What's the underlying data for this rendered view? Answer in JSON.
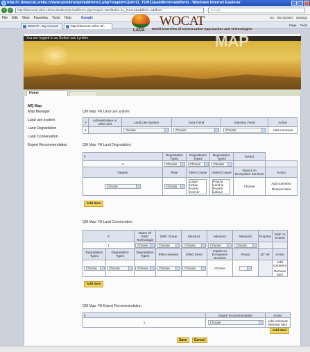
{
  "window": {
    "title": "http://c.dewocat.unibe.ch/wocatonline/qm/addform1.php?mapid=1&id=11_TUH11&addform=addform - Windows Internet Explorer",
    "min": "_",
    "max": "□",
    "close": "x"
  },
  "address": {
    "url": "http://dewocat.unibe.ch/wocatonline/qm/addform1.php?mapid=1&mf0okni=11_TUH11&addform=addform",
    "search_placeholder": "Google"
  },
  "menu": {
    "items": [
      "File",
      "Edit",
      "View",
      "Favorites",
      "Tools",
      "Help"
    ],
    "google_label": "Google",
    "go_label": "Go",
    "blocked_label": "86 blocked",
    "settings_label": "Settings",
    "tools_label": "Tools"
  },
  "tabs": [
    {
      "label": "WOCAT - My Account"
    },
    {
      "label": "http://dewocat.unibe.ch/..."
    }
  ],
  "tab_tools": {
    "page": "Page",
    "tools": "Tools"
  },
  "login": {
    "text": "You are logged in as Godert van Lynden"
  },
  "banner": {
    "lada": "LADA",
    "wocat": "WOCAT",
    "subtitle": "World Overview of Conservation Approaches and Technologies",
    "map": "MAP"
  },
  "home_tab": "Home",
  "sidebar": {
    "items": [
      "MQ Map",
      "Map Manager",
      "Land use system",
      "Land Degradation",
      "Land Conservation",
      "Expert Recommendation"
    ]
  },
  "land_use": {
    "title": "QM Map: Fill Land use system.",
    "headers": [
      "#",
      "Administrative or other unit",
      "Land Use System",
      "Area Trend",
      "Intensity Trend",
      "Action"
    ],
    "row": {
      "n": "1",
      "sel1": "choose",
      "sel2": "Choose",
      "sel3": "Choose",
      "action": "Add comment"
    }
  },
  "land_deg": {
    "title": "QM Map: Fill Land Degradation.",
    "headers": [
      "#",
      "Degradation Type1",
      "Degradation Type2",
      "Degradation Type3",
      "Extent"
    ],
    "row_n": "1",
    "sel": "Choose",
    "sub_headers": [
      "Degree",
      "Rate",
      "Direct cause",
      "Indirect cause",
      "Impact on Ecosystem Services",
      "Action"
    ],
    "direct_opts": [
      "Large-",
      "Urban",
      "Forest",
      "Conver"
    ],
    "indirect_opts": [
      "Popula",
      "Land te",
      "Poverti",
      "Labour"
    ],
    "add_comment": "Add comment",
    "remove": "Remove Item",
    "add_item": "Add Item"
  },
  "land_cons": {
    "title": "QM Map: Fill Land Conservation.",
    "headers": [
      "#",
      "Name Of SWC Technologie",
      "SWC Group",
      "Mesure1",
      "Mesure2",
      "Mesure3",
      "Purpose",
      "SWC % of area"
    ],
    "row_n": "1",
    "sel": "Choose",
    "sub_headers": [
      "Degradation Type1",
      "Degradation Type2",
      "Degradation Type3",
      "Effect-iveness",
      "Effect trend",
      "Impact on Ecosystem Services",
      "Period",
      "QT ref.",
      "Action"
    ],
    "add_comment": "Add comment",
    "remove": "Remove Item",
    "add_item": "Add Item"
  },
  "expert": {
    "title": "QM Map: Fill Expert Recommendation.",
    "headers": [
      "#",
      "Expert recommendation",
      "Action"
    ],
    "row_n": "1",
    "sel": "Choose",
    "add_comment": "Add comment",
    "remove": "Remove Item",
    "add_item": "Add Item"
  },
  "footer": {
    "save": "Save",
    "cancel": "Cancel"
  }
}
